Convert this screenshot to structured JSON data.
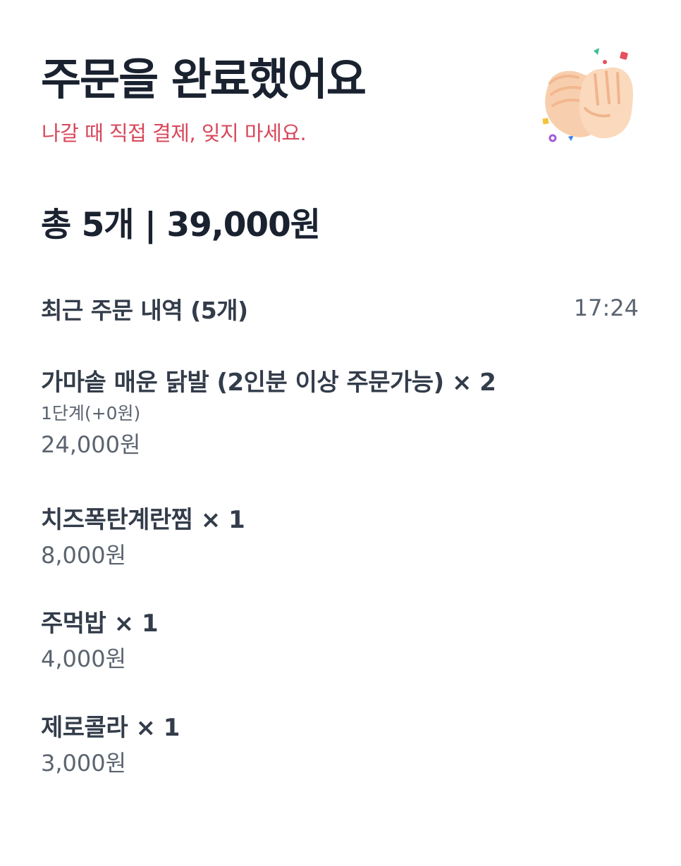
{
  "header": {
    "title": "주문을 완료했어요",
    "subtitle": "나갈 때 직접 결제, 잊지 마세요.",
    "illustration_icon": "clapping-hands-icon"
  },
  "summary": {
    "total_text": "총 5개 | 39,000원"
  },
  "recent_orders": {
    "title": "최근 주문 내역 (5개)",
    "time": "17:24",
    "items": [
      {
        "name": "가마솥 매운 닭발 (2인분 이상 주문가능) × 2",
        "option": "1단계(+0원)",
        "price": "24,000원"
      },
      {
        "name": "치즈폭탄계란찜 × 1",
        "price": "8,000원"
      },
      {
        "name": "주먹밥 × 1",
        "price": "4,000원"
      },
      {
        "name": "제로콜라 × 1",
        "price": "3,000원"
      }
    ]
  },
  "colors": {
    "title": "#1a2230",
    "subtitle_accent": "#d8475a",
    "secondary_text": "#5b6470"
  }
}
